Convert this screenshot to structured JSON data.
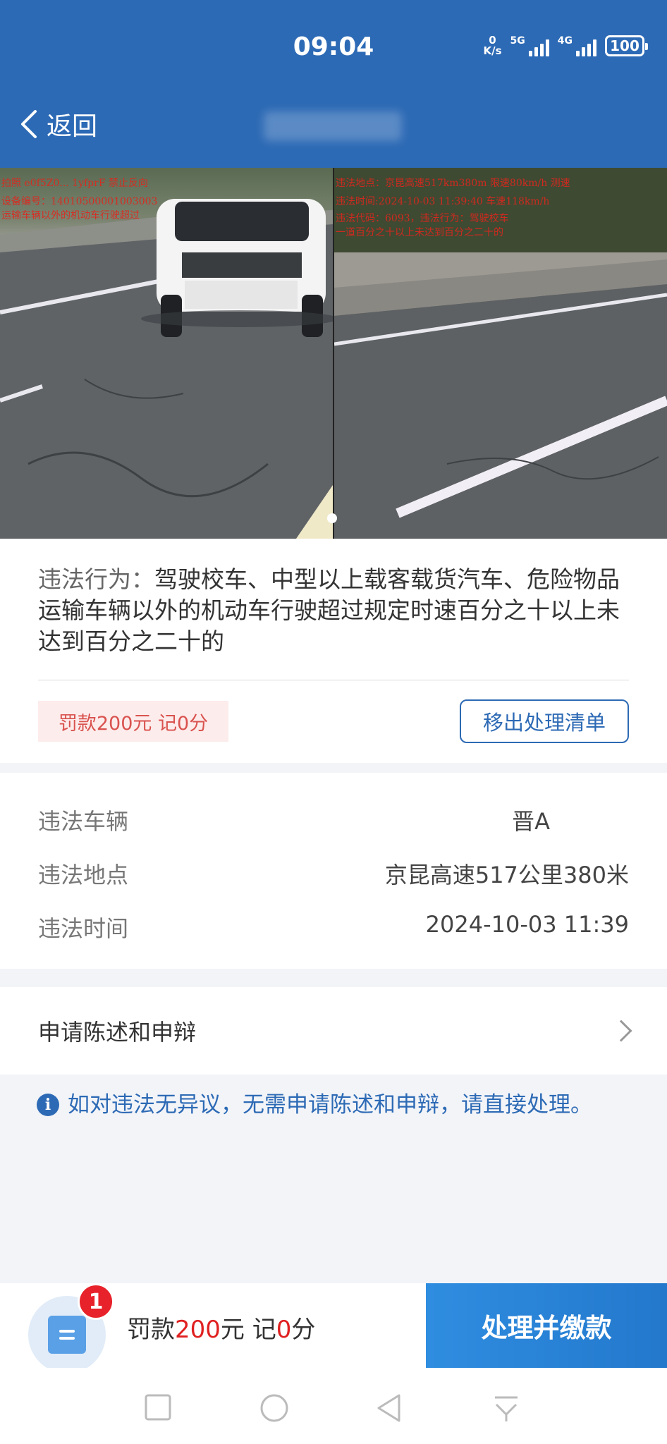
{
  "status_bar": {
    "time": "09:04",
    "net_speed_value": "0",
    "net_speed_unit": "K/s",
    "sim1_label": "5G",
    "sim2_label": "4G",
    "battery": "100"
  },
  "nav": {
    "back_label": "返回"
  },
  "photos": {
    "left_overlay_lines": [
      "拍照 e0f5Z0... 1yfprF 禁止反向",
      "设备编号：14010500001003003",
      "运输车辆以外的机动车行驶超过"
    ],
    "right_overlay_lines": [
      "违法地点：京昆高速517km380m 限速80km/h 测速",
      "违法时间:2024-10-03 11:39:40 车速118km/h",
      "违法代码：6093，违法行为：驾驶校车",
      "一道百分之十以上未达到百分之二十的"
    ]
  },
  "violation": {
    "behavior_label": "违法行为：",
    "behavior_text": "驾驶校车、中型以上载客载货汽车、危险物品运输车辆以外的机动车行驶超过规定时速百分之十以上未达到百分之二十的",
    "fine_tag": "罚款200元 记0分",
    "remove_button": "移出处理清单"
  },
  "details": [
    {
      "key": "违法车辆",
      "value": "晋A"
    },
    {
      "key": "违法地点",
      "value": "京昆高速517公里380米"
    },
    {
      "key": "违法时间",
      "value": "2024-10-03 11:39"
    }
  ],
  "appeal": {
    "label": "申请陈述和申辩"
  },
  "notice": {
    "icon": "i",
    "text": "如对违法无异议，无需申请陈述和申辩，请直接处理。"
  },
  "bottom": {
    "badge_count": "1",
    "fine_prefix": "罚款",
    "fine_amount": "200",
    "fine_mid": "元 记",
    "points": "0",
    "fine_suffix": "分",
    "pay_button": "处理并缴款"
  },
  "colors": {
    "primary": "#2d6ab5",
    "danger": "#e02020",
    "badge": "#e8222a"
  }
}
